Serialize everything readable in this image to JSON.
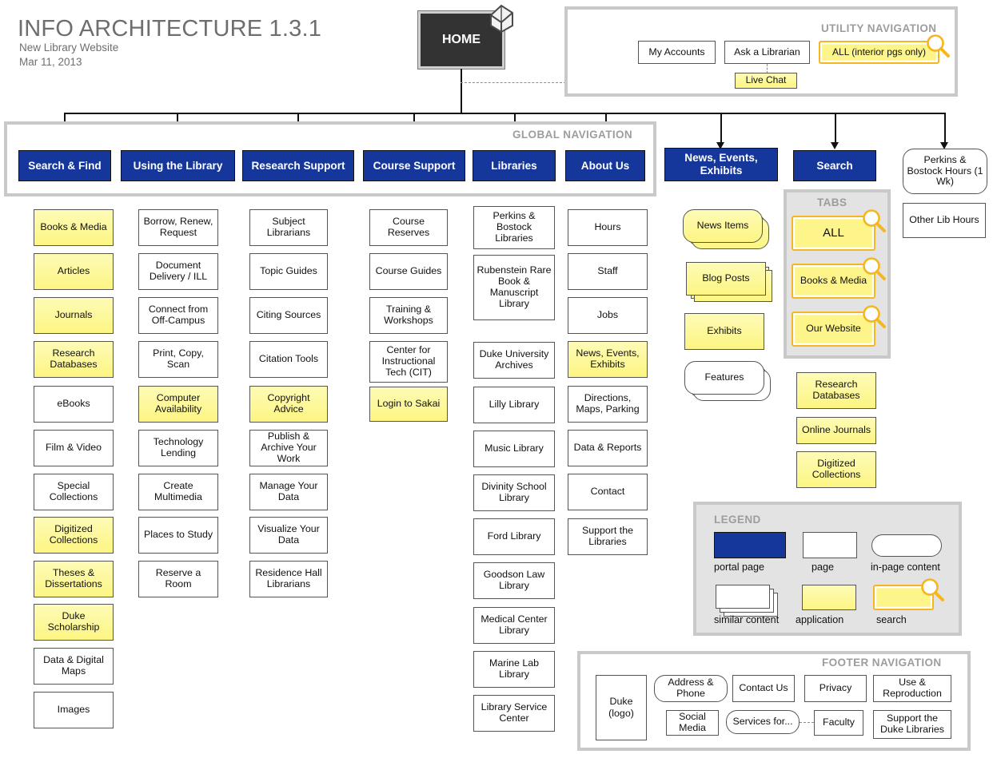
{
  "header": {
    "title": "INFO ARCHITECTURE 1.3.1",
    "subtitle": "New Library Website",
    "date": "Mar 11, 2013"
  },
  "home": {
    "label": "HOME",
    "icon": "house-icon"
  },
  "panels": {
    "utility": "UTILITY NAVIGATION",
    "global": "GLOBAL NAVIGATION",
    "tabs": "TABS",
    "legend": "LEGEND",
    "footer": "FOOTER NAVIGATION"
  },
  "utility_nav": {
    "items": [
      {
        "label": "My Accounts",
        "type": "page"
      },
      {
        "label": "Ask a Librarian",
        "type": "page"
      },
      {
        "label": "ALL (interior pgs only)",
        "type": "search"
      }
    ],
    "live_chat": {
      "label": "Live Chat",
      "type": "application"
    }
  },
  "global_nav": [
    {
      "label": "Search & Find",
      "type": "portal"
    },
    {
      "label": "Using the Library",
      "type": "portal"
    },
    {
      "label": "Research Support",
      "type": "portal"
    },
    {
      "label": "Course Support",
      "type": "portal"
    },
    {
      "label": "Libraries",
      "type": "portal"
    },
    {
      "label": "About Us",
      "type": "portal"
    }
  ],
  "outside_nav": [
    {
      "label": "News, Events, Exhibits",
      "type": "portal"
    },
    {
      "label": "Search",
      "type": "portal"
    },
    {
      "label": "Perkins & Bostock Hours (1 Wk)",
      "type": "in-page"
    }
  ],
  "columns": {
    "search_and_find": [
      {
        "label": "Books & Media",
        "type": "application"
      },
      {
        "label": "Articles",
        "type": "application"
      },
      {
        "label": "Journals",
        "type": "application"
      },
      {
        "label": "Research Databases",
        "type": "application"
      },
      {
        "label": "eBooks",
        "type": "page"
      },
      {
        "label": "Film & Video",
        "type": "page"
      },
      {
        "label": "Special Collections",
        "type": "page"
      },
      {
        "label": "Digitized Collections",
        "type": "application"
      },
      {
        "label": "Theses & Dissertations",
        "type": "application"
      },
      {
        "label": "Duke Scholarship",
        "type": "application"
      },
      {
        "label": "Data & Digital Maps",
        "type": "page"
      },
      {
        "label": "Images",
        "type": "page"
      }
    ],
    "using_the_library": [
      {
        "label": "Borrow, Renew, Request",
        "type": "page"
      },
      {
        "label": "Document Delivery / ILL",
        "type": "page"
      },
      {
        "label": "Connect from Off-Campus",
        "type": "page"
      },
      {
        "label": "Print, Copy, Scan",
        "type": "page"
      },
      {
        "label": "Computer Availability",
        "type": "application"
      },
      {
        "label": "Technology Lending",
        "type": "page"
      },
      {
        "label": "Create Multimedia",
        "type": "page"
      },
      {
        "label": "Places to Study",
        "type": "page"
      },
      {
        "label": "Reserve a Room",
        "type": "page"
      }
    ],
    "research_support": [
      {
        "label": "Subject Librarians",
        "type": "page"
      },
      {
        "label": "Topic Guides",
        "type": "page"
      },
      {
        "label": "Citing Sources",
        "type": "page"
      },
      {
        "label": "Citation Tools",
        "type": "page"
      },
      {
        "label": "Copyright Advice",
        "type": "application"
      },
      {
        "label": "Publish & Archive Your Work",
        "type": "page"
      },
      {
        "label": "Manage Your Data",
        "type": "page"
      },
      {
        "label": "Visualize Your Data",
        "type": "page"
      },
      {
        "label": "Residence Hall Librarians",
        "type": "page"
      }
    ],
    "course_support": [
      {
        "label": "Course Reserves",
        "type": "page"
      },
      {
        "label": "Course Guides",
        "type": "page"
      },
      {
        "label": "Training & Workshops",
        "type": "page"
      },
      {
        "label": "Center for Instructional Tech (CIT)",
        "type": "page"
      },
      {
        "label": "Login to Sakai",
        "type": "application"
      }
    ],
    "libraries": [
      {
        "label": "Perkins & Bostock Libraries",
        "type": "page"
      },
      {
        "label": "Rubenstein Rare Book & Manuscript Library",
        "type": "page"
      },
      {
        "label": "Duke University Archives",
        "type": "page"
      },
      {
        "label": "Lilly Library",
        "type": "page"
      },
      {
        "label": "Music Library",
        "type": "page"
      },
      {
        "label": "Divinity School Library",
        "type": "page"
      },
      {
        "label": "Ford Library",
        "type": "page"
      },
      {
        "label": "Goodson Law Library",
        "type": "page"
      },
      {
        "label": "Medical Center Library",
        "type": "page"
      },
      {
        "label": "Marine Lab Library",
        "type": "page"
      },
      {
        "label": "Library Service Center",
        "type": "page"
      }
    ],
    "about_us": [
      {
        "label": "Hours",
        "type": "page"
      },
      {
        "label": "Staff",
        "type": "page"
      },
      {
        "label": "Jobs",
        "type": "page"
      },
      {
        "label": "News, Events, Exhibits",
        "type": "application"
      },
      {
        "label": "Directions, Maps, Parking",
        "type": "page"
      },
      {
        "label": "Data & Reports",
        "type": "page"
      },
      {
        "label": "Contact",
        "type": "page"
      },
      {
        "label": "Support the Libraries",
        "type": "page"
      }
    ],
    "news_events": [
      {
        "label": "News Items",
        "type": "application-stacked-round"
      },
      {
        "label": "Blog Posts",
        "type": "application-stacked"
      },
      {
        "label": "Exhibits",
        "type": "application"
      },
      {
        "label": "Features",
        "type": "page-stacked-round"
      }
    ],
    "search_tabs": [
      {
        "label": "ALL",
        "type": "search"
      },
      {
        "label": "Books & Media",
        "type": "search"
      },
      {
        "label": "Our Website",
        "type": "search"
      }
    ],
    "search_other": [
      {
        "label": "Research Databases",
        "type": "application"
      },
      {
        "label": "Online Journals",
        "type": "application"
      },
      {
        "label": "Digitized Collections",
        "type": "application"
      }
    ],
    "hours": [
      {
        "label": "Other Lib Hours",
        "type": "page"
      }
    ]
  },
  "legend": {
    "title": "LEGEND",
    "items": [
      {
        "label": "portal page",
        "swatch": "portal",
        "color": "#15379b"
      },
      {
        "label": "page",
        "swatch": "page",
        "color": "#ffffff"
      },
      {
        "label": "in-page content",
        "swatch": "in-page",
        "color": "#ffffff"
      },
      {
        "label": "similar content",
        "swatch": "stacked",
        "color": "#ffffff"
      },
      {
        "label": "application",
        "swatch": "application",
        "color": "#fdf582"
      },
      {
        "label": "search",
        "swatch": "search",
        "color": "#fdf58a"
      }
    ]
  },
  "footer_nav": {
    "logo": "Duke (logo)",
    "items": [
      {
        "label": "Address & Phone",
        "type": "in-page"
      },
      {
        "label": "Contact Us",
        "type": "page"
      },
      {
        "label": "Privacy",
        "type": "page"
      },
      {
        "label": "Use & Reproduction",
        "type": "page"
      },
      {
        "label": "Social Media",
        "type": "page-stacked"
      },
      {
        "label": "Services for...",
        "type": "in-page"
      },
      {
        "label": "Faculty",
        "type": "page-stacked"
      },
      {
        "label": "Support the Duke Libraries",
        "type": "page"
      }
    ]
  },
  "colors": {
    "portal_blue": "#15379b",
    "application_yellow": "#fdf582",
    "search_gold": "#f5b61e",
    "panel_gray": "#c9c9c9",
    "label_gray": "#9d9d9d",
    "home_dark": "#333333"
  }
}
